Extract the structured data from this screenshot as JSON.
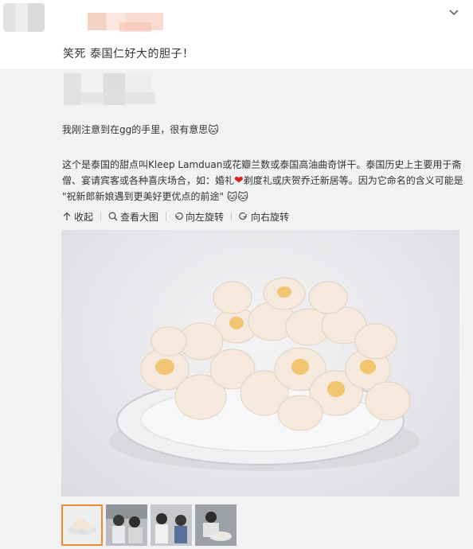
{
  "post": {
    "text": "笑死 泰国仁好大的胆子！",
    "menu_icon": "chevron-down-icon"
  },
  "repost": {
    "line1": "我刚注意到在gg的手里，很有意思",
    "line1_emoji": "🐱",
    "para_part1": "这个是泰国的甜点叫Kleep Lamduan或花瓣兰数或泰国高油曲奇饼干。泰国历史上主要用于斋僧、宴请宾客或各种喜庆场合，如：婚礼",
    "heart": "❤",
    "para_part2": "剃度礼或庆贺乔迁新居等。因为它命名的含义可能是 \"祝新郎新娘遇到更美好更优点的前途\"",
    "para_emoji": "🐱🐱",
    "toolbar": {
      "collapse": "收起",
      "view_large": "查看大图",
      "rotate_left": "向左旋转",
      "rotate_right": "向右旋转"
    },
    "thumbnails": [
      {
        "name": "cookie-plate",
        "active": true
      },
      {
        "name": "people-photo-1",
        "active": false
      },
      {
        "name": "people-photo-2",
        "active": false
      },
      {
        "name": "people-photo-3",
        "active": false
      }
    ]
  },
  "colors": {
    "repost_bg": "#f2f2f5",
    "active_thumb_border": "#f28c28",
    "heart": "#e0211b"
  }
}
